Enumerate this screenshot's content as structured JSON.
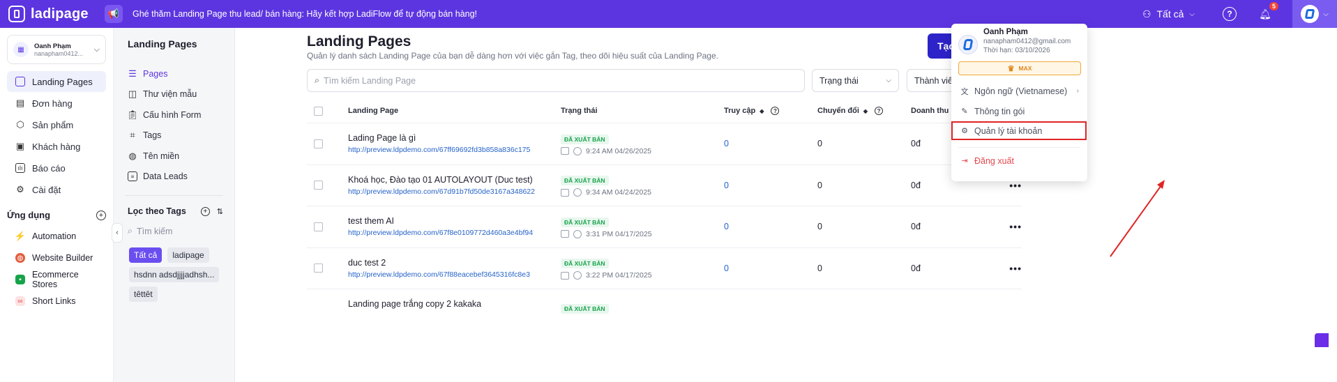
{
  "topbar": {
    "logo": "ladipage",
    "announcement": "Ghé thăm Landing Page thu lead/ bán hàng: Hãy kết hợp LadiFlow để tự động bán hàng!",
    "team_label": "Tất cả",
    "notification_count": "5",
    "help": "?"
  },
  "account": {
    "name": "Oanh Phạm",
    "email": "nanapham0412..."
  },
  "nav": [
    {
      "label": "Landing Pages",
      "icon": "landing-pages-icon",
      "active": true
    },
    {
      "label": "Đơn hàng",
      "icon": "orders-icon"
    },
    {
      "label": "Sản phẩm",
      "icon": "products-icon"
    },
    {
      "label": "Khách hàng",
      "icon": "customers-icon"
    },
    {
      "label": "Báo cáo",
      "icon": "report-icon"
    },
    {
      "label": "Cài đặt",
      "icon": "settings-icon"
    }
  ],
  "apps": {
    "title": "Ứng dụng",
    "items": [
      {
        "label": "Automation",
        "color": "#f59e0b"
      },
      {
        "label": "Website Builder",
        "color": "#e25c3b"
      },
      {
        "label": "Ecommerce Stores",
        "color": "#16a34a"
      },
      {
        "label": "Short Links",
        "color": "#e5484d"
      }
    ]
  },
  "side2": {
    "title": "Landing Pages",
    "items": [
      {
        "label": "Pages",
        "active": true
      },
      {
        "label": "Thư viện mẫu"
      },
      {
        "label": "Cấu hình Form"
      },
      {
        "label": "Tags"
      },
      {
        "label": "Tên miền"
      },
      {
        "label": "Data Leads"
      }
    ],
    "tags_title": "Lọc theo Tags",
    "tag_search_placeholder": "Tìm kiếm",
    "tags": [
      "Tất cả",
      "ladipage",
      "hsdnn adsdjjjjadhsh...",
      "têttêt"
    ]
  },
  "main": {
    "title": "Landing Pages",
    "subtitle": "Quản lý danh sách Landing Page của bạn dễ dàng hơn với việc gắn Tag, theo dõi hiệu suất của Landing Page.",
    "create_label": "Tạo",
    "search_placeholder": "Tìm kiếm Landing Page",
    "filter_status": "Trạng thái",
    "filter_member": "Thành viên"
  },
  "table": {
    "headers": {
      "name": "Landing Page",
      "status": "Trạng thái",
      "visits": "Truy cập",
      "conversions": "Chuyển đổi",
      "revenue": "Doanh thu"
    },
    "rows": [
      {
        "name": "Lading Page là gì",
        "url": "http://preview.ldpdemo.com/67ff69692fd3b858a836c175",
        "status": "ĐÃ XUẤT BẢN",
        "time": "9:24 AM 04/26/2025",
        "visits": "0",
        "conversions": "0",
        "revenue": "0đ"
      },
      {
        "name": "Khoá học, Đào tạo 01 AUTOLAYOUT (Duc test)",
        "url": "http://preview.ldpdemo.com/67d91b7fd50de3167a348622",
        "status": "ĐÃ XUẤT BẢN",
        "time": "9:34 AM 04/24/2025",
        "visits": "0",
        "conversions": "0",
        "revenue": "0đ"
      },
      {
        "name": "test them AI",
        "url": "http://preview.ldpdemo.com/67f8e0109772d460a3e4bf94",
        "status": "ĐÃ XUẤT BẢN",
        "time": "3:31 PM 04/17/2025",
        "visits": "0",
        "conversions": "0",
        "revenue": "0đ"
      },
      {
        "name": "duc test 2",
        "url": "http://preview.ldpdemo.com/67f88eacebef3645316fc8e3",
        "status": "ĐÃ XUẤT BẢN",
        "time": "3:22 PM 04/17/2025",
        "visits": "0",
        "conversions": "0",
        "revenue": "0đ"
      },
      {
        "name": "Landing page trắng copy 2 kakaka",
        "url": "",
        "status": "ĐÃ XUẤT BẢN",
        "time": "",
        "visits": "",
        "conversions": "",
        "revenue": ""
      }
    ],
    "more": "•••"
  },
  "dropdown": {
    "name": "Oanh Phạm",
    "email": "nanapham0412@gmail.com",
    "expiry": "Thời hạn: 03/10/2026",
    "plan": "MAX",
    "language": "Ngôn ngữ (Vietnamese)",
    "package_info": "Thông tin gói",
    "manage_account": "Quản lý tài khoản",
    "logout": "Đăng xuất"
  }
}
